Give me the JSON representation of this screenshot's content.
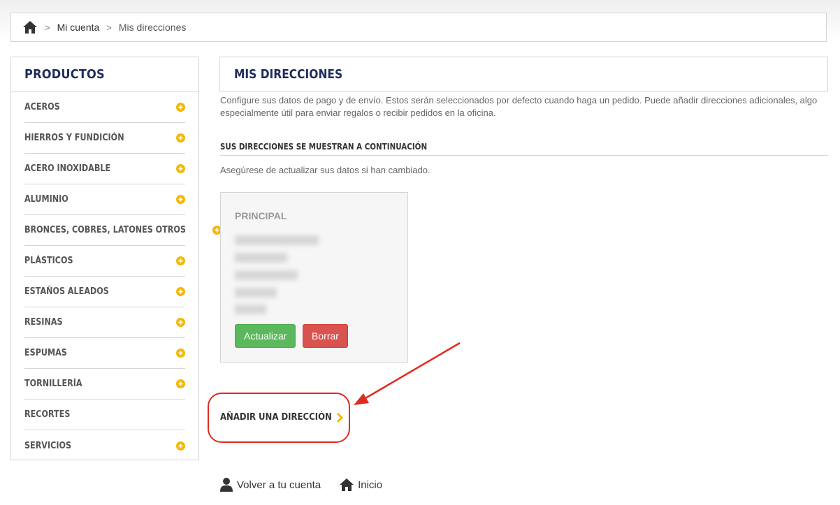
{
  "breadcrumb": {
    "separator": ">",
    "items": [
      "Mi cuenta",
      "Mis direcciones"
    ]
  },
  "sidebar": {
    "title": "PRODUCTOS",
    "items": [
      {
        "label": "ACEROS",
        "expandable": true
      },
      {
        "label": "HIERROS Y FUNDICIÓN",
        "expandable": true
      },
      {
        "label": "ACERO INOXIDABLE",
        "expandable": true
      },
      {
        "label": "ALUMINIO",
        "expandable": true
      },
      {
        "label": "BRONCES, COBRES, LATONES OTROS",
        "expandable": true
      },
      {
        "label": "PLÁSTICOS",
        "expandable": true
      },
      {
        "label": "ESTAÑOS ALEADOS",
        "expandable": true
      },
      {
        "label": "RESINAS",
        "expandable": true
      },
      {
        "label": "ESPUMAS",
        "expandable": true
      },
      {
        "label": "TORNILLERÍA",
        "expandable": true
      },
      {
        "label": "RECORTES",
        "expandable": false
      },
      {
        "label": "SERVICIOS",
        "expandable": true
      }
    ]
  },
  "main": {
    "heading": "MIS DIRECCIONES",
    "intro": "Configure sus datos de pago y de envío. Estos serán seleccionados por defecto cuando haga un pedido. Puede añadir direcciones adicionales, algo especialmente útil para enviar regalos o recibir pedidos en la oficina.",
    "subheading": "SUS DIRECCIONES SE MUESTRAN A CONTINUACIÓN",
    "note": "Asegúrese de actualizar sus datos si han cambiado.",
    "address": {
      "title": "PRINCIPAL",
      "update_label": "Actualizar",
      "delete_label": "Borrar"
    },
    "add_address_label": "AÑADIR UNA DIRECCIÓN"
  },
  "footer": {
    "back_label": "Volver a tu cuenta",
    "home_label": "Inicio"
  },
  "colors": {
    "heading": "#1e2d5a",
    "accent_yellow": "#f5b800",
    "update_green": "#5cb85c",
    "delete_red": "#d9534f",
    "annotation_red": "#e02b20"
  },
  "icons": {
    "breadcrumb_home": "home-icon",
    "expand": "plus-circle-icon",
    "add_chevron": "chevron-right-icon",
    "footer_back": "user-icon",
    "footer_home": "home-icon"
  }
}
